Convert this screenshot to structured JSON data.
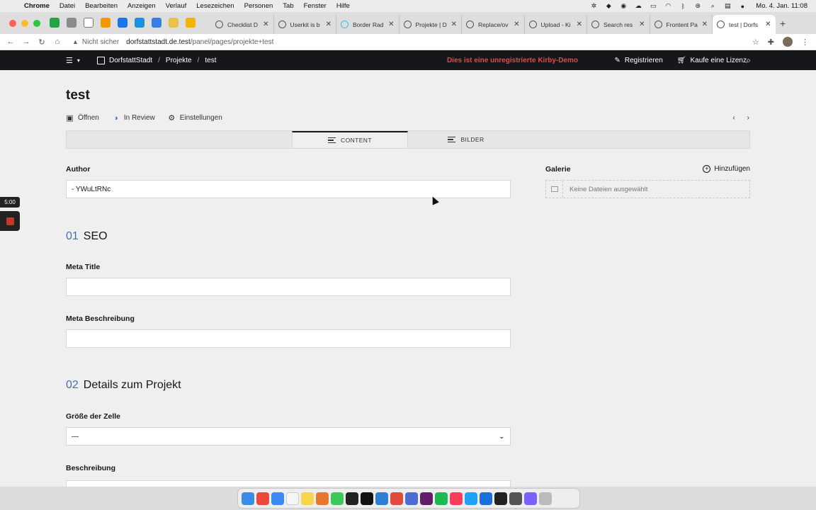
{
  "menubar": {
    "app": "Chrome",
    "items": [
      "Datei",
      "Bearbeiten",
      "Anzeigen",
      "Verlauf",
      "Lesezeichen",
      "Personen",
      "Tab",
      "Fenster",
      "Hilfe"
    ],
    "clock": "Mo. 4. Jan.  11:08"
  },
  "browser": {
    "tabs": [
      {
        "title": "Checklist D"
      },
      {
        "title": "Userkit is b"
      },
      {
        "title": "Border Rad"
      },
      {
        "title": "Projekte | D"
      },
      {
        "title": "Replace/ov"
      },
      {
        "title": "Upload - Ki"
      },
      {
        "title": "Search res"
      },
      {
        "title": "Frontent Pa"
      },
      {
        "title": "test | Dorfs"
      }
    ],
    "insecure_label": "Nicht sicher",
    "url_host": "dorfstattstadt.de.test",
    "url_path": "/panel/pages/projekte+test"
  },
  "kirby": {
    "site": "DorfstattStadt",
    "crumbs": [
      "Projekte",
      "test"
    ],
    "demo_notice": "Dies ist eine unregistrierte Kirby-Demo",
    "register": "Registrieren",
    "buy": "Kaufe eine Lizenz"
  },
  "page": {
    "title": "test",
    "actions": {
      "open": "Öffnen",
      "status": "In Review",
      "settings": "Einstellungen"
    },
    "tabs": [
      {
        "label": "CONTENT",
        "active": true
      },
      {
        "label": "BILDER",
        "active": false
      }
    ],
    "fields": {
      "author_label": "Author",
      "author_value": "- YWuLtRNc",
      "seo_number": "01",
      "seo_title": "SEO",
      "meta_title_label": "Meta Title",
      "meta_title_value": "",
      "meta_desc_label": "Meta Beschreibung",
      "meta_desc_value": "",
      "details_number": "02",
      "details_title": "Details zum Projekt",
      "cell_size_label": "Größe der Zelle",
      "cell_size_value": "—",
      "description_label": "Beschreibung"
    },
    "gallery": {
      "label": "Galerie",
      "add": "Hinzufügen",
      "empty": "Keine Dateien ausgewählt"
    }
  },
  "recording": {
    "timer": "5:00"
  },
  "colors": {
    "demo_red": "#e04a4a",
    "section_number_blue": "#4271ae",
    "topbar": "#16171a"
  }
}
